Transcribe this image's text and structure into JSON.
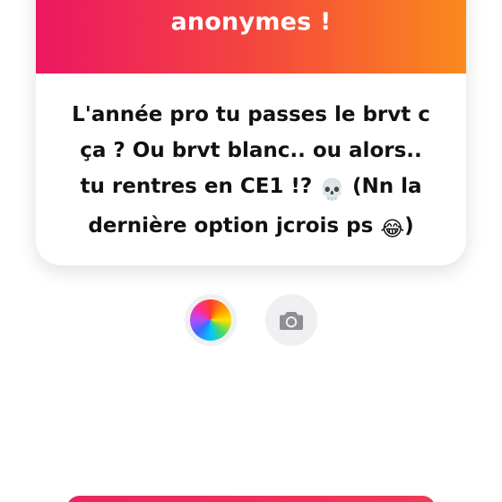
{
  "card": {
    "header_text": "anonymes !",
    "message_lines": [
      "L'année pro tu passes le brvt c",
      "ça ? Ou brvt blanc.. ou alors..",
      "tu rentres en CE1 !?",
      "(Nn la",
      "dernière option jcrois ps",
      ")"
    ],
    "skull_emoji": "💀",
    "laugh_emoji": "😂"
  },
  "colors": {
    "gradient_start": "#ec1763",
    "gradient_end": "#fb8a1c",
    "icon_gray": "#8e8e93"
  },
  "icons": {
    "color_button": "color-wheel-icon",
    "camera_button": "camera-icon"
  }
}
